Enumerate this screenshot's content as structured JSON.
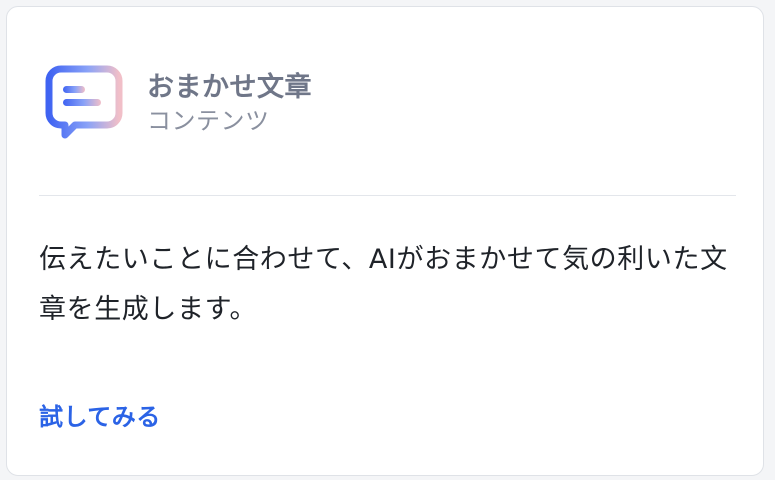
{
  "card": {
    "title": "おまかせ文章",
    "subtitle": "コンテンツ",
    "description": "伝えたいことに合わせて、AIがおまかせて気の利いた文章を生成します。",
    "action_label": "試してみる"
  },
  "icon": {
    "name": "chat-bubble-icon",
    "gradient_start": "#3f63f2",
    "gradient_mid": "#8aa2f7",
    "gradient_end": "#f1bfc8"
  },
  "colors": {
    "link": "#2b63e6",
    "title": "#6f7688",
    "subtitle": "#8a909f",
    "body": "#1f2329"
  }
}
